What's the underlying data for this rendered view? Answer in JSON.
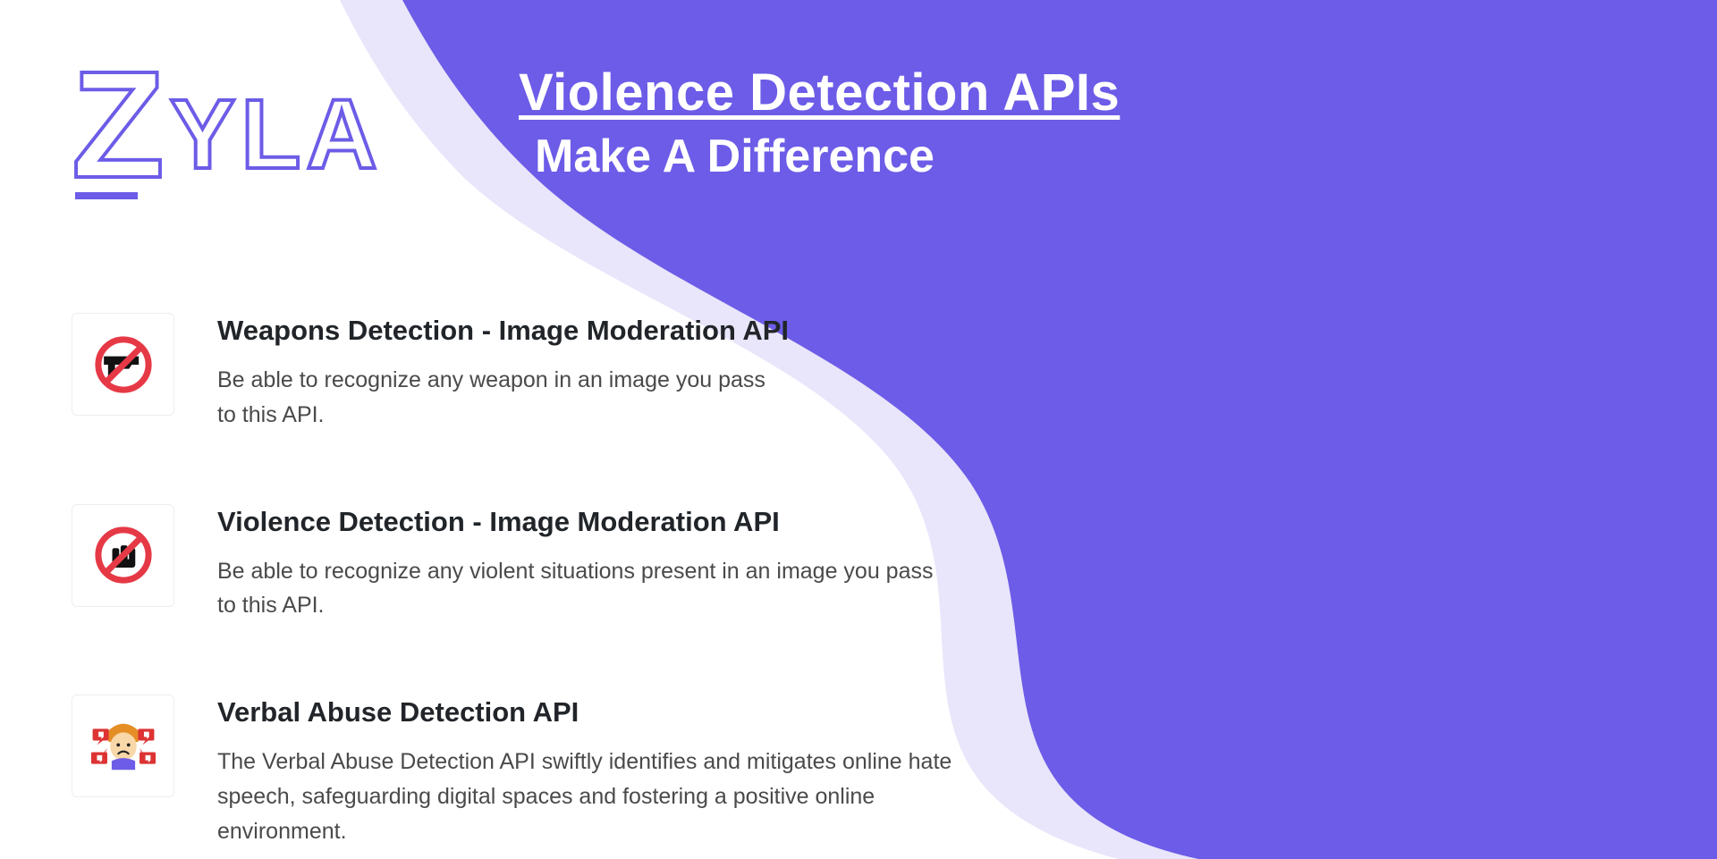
{
  "brand": {
    "name_z": "Z",
    "name_rest": "YLA"
  },
  "hero": {
    "title": "Violence Detection APIs",
    "subtitle": "Make A Difference"
  },
  "colors": {
    "purple_main": "#6C5CE7",
    "purple_light": "#E9E5FB",
    "text_dark": "#212529",
    "text_body": "#4a4a4a",
    "prohibit_red": "#E63946"
  },
  "items": [
    {
      "icon": "no-weapon-icon",
      "title": "Weapons Detection - Image Moderation API",
      "desc": "Be able to recognize any weapon in an image you pass to this API."
    },
    {
      "icon": "no-violence-icon",
      "title": "Violence Detection - Image Moderation API",
      "desc": "Be able to recognize any violent situations present in an image you pass to this API."
    },
    {
      "icon": "verbal-abuse-icon",
      "title": "Verbal Abuse Detection API",
      "desc": "The Verbal Abuse Detection API swiftly identifies and mitigates online hate speech, safeguarding digital spaces and fostering a positive online environment."
    }
  ]
}
